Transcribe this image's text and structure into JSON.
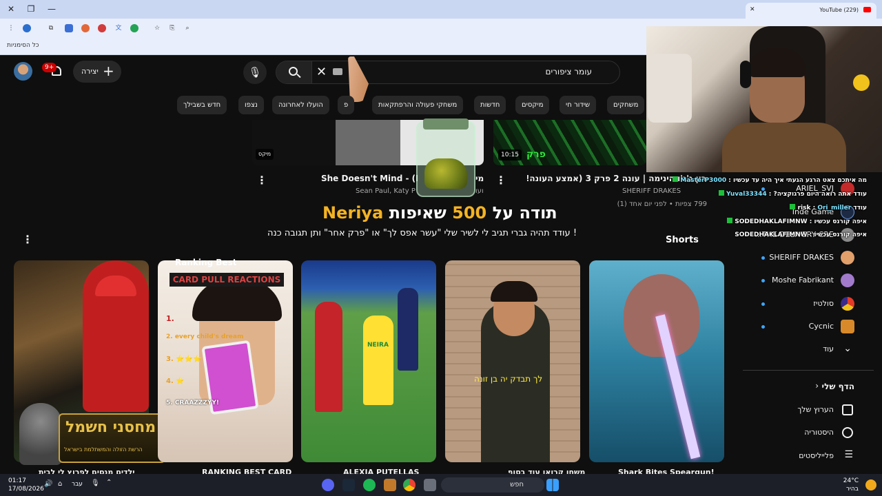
{
  "browser": {
    "tab_title": "(229) YouTube",
    "bookmarks_label": "כל הסימניות"
  },
  "header": {
    "notifications_count": "9+",
    "create_label": "יצירה",
    "search_value": "עומר ציפורים"
  },
  "chips": [
    "משחקים",
    "שידור חי",
    "מיקסים",
    "חדשות",
    "משחקי פעולה והרפתקאות",
    "פ",
    "הועלו לאחרונה",
    "נצפו",
    "חדש בשבילך"
  ],
  "top_row": {
    "mix_badge": "מיקס",
    "duration_badge": "10:15",
    "video1_title": "She Doesn't Mind - (H",
    "video1_meta": "Sean Paul, Katy P",
    "video1_title_suffix": "מי",
    "video1_meta_suffix": "ועו",
    "video2_title": "רון ג'ג'ו הינימה | עונה 2 פרק 3 (אמצע העונה!)",
    "video2_channel": "SHERIFF DRAKES",
    "video2_meta": "799 צפיות • לפני יום אחד (1)",
    "thumb_text": "פרק"
  },
  "overlay": {
    "line1_pre": "תודה על",
    "line1_number": "500",
    "line1_post": "שאיפות",
    "line1_name": "Neriya",
    "line2": "! עודד תהיה גברי תגיב לי לשיר שלי \"עשר אפס לך\" או \"פרק אחר\" ותן תגובה כנה"
  },
  "shorts": [
    {
      "title": "ילדים מנסים לפרוץ לי לבית",
      "logo_big": "מחסני חשמל",
      "logo_small": "הרשת הזולה והמשתלמת בישראל"
    },
    {
      "title": "RANKING BEST CARD",
      "top_text": "Ranking Best",
      "banner": "CARD PULL REACTIONS",
      "list": [
        "1.",
        "2. every child's dream",
        "3. ⭐⭐⭐",
        "4. ⭐",
        "5. CRAAZZZYY!"
      ]
    },
    {
      "title": "ALEXIA PUTELLAS",
      "jersey": "NEIRA"
    },
    {
      "title": "משחו קרואו עוד בסוף",
      "caption": "לך תבדק יה בן זונה"
    },
    {
      "title": "Shark Bites Speargun!"
    }
  ],
  "sidebar": {
    "subscriptions": [
      "ARIEL_SVJ",
      "Inde Game",
      "THE DELIVERY CRE...",
      "SHERIFF DRAKES",
      "Moshe Fabrikant",
      "סולטיז",
      "Cycnic"
    ],
    "more_label": "עוד",
    "you_label": "הדף שלי",
    "you_items": [
      "הערוץ שלך",
      "היסטוריה",
      "פלייליסטים"
    ],
    "shorts_label": "Shorts"
  },
  "chat": [
    {
      "user": "MasterP3000",
      "text": "מה איתכם צאט הרגע הגעתי איך היה עד עכשיו"
    },
    {
      "user": "Yuval33344",
      "text": "עודד אתה רואה היום פרגוקציה?"
    },
    {
      "user": "Ori_miller",
      "text": "עודד risk"
    },
    {
      "user": "SODEDHAKLAFIMNW",
      "text": "איפה קורנס עכשיו"
    },
    {
      "user": "SODEDHAKLAFIMNW",
      "text": "איפה קורנס עכשיו"
    }
  ],
  "taskbar": {
    "time": "01:17",
    "date": "17/08/2026",
    "lang": "עבר",
    "search_placeholder": "חפש",
    "temp": "24°C",
    "weather": "בהיר"
  }
}
